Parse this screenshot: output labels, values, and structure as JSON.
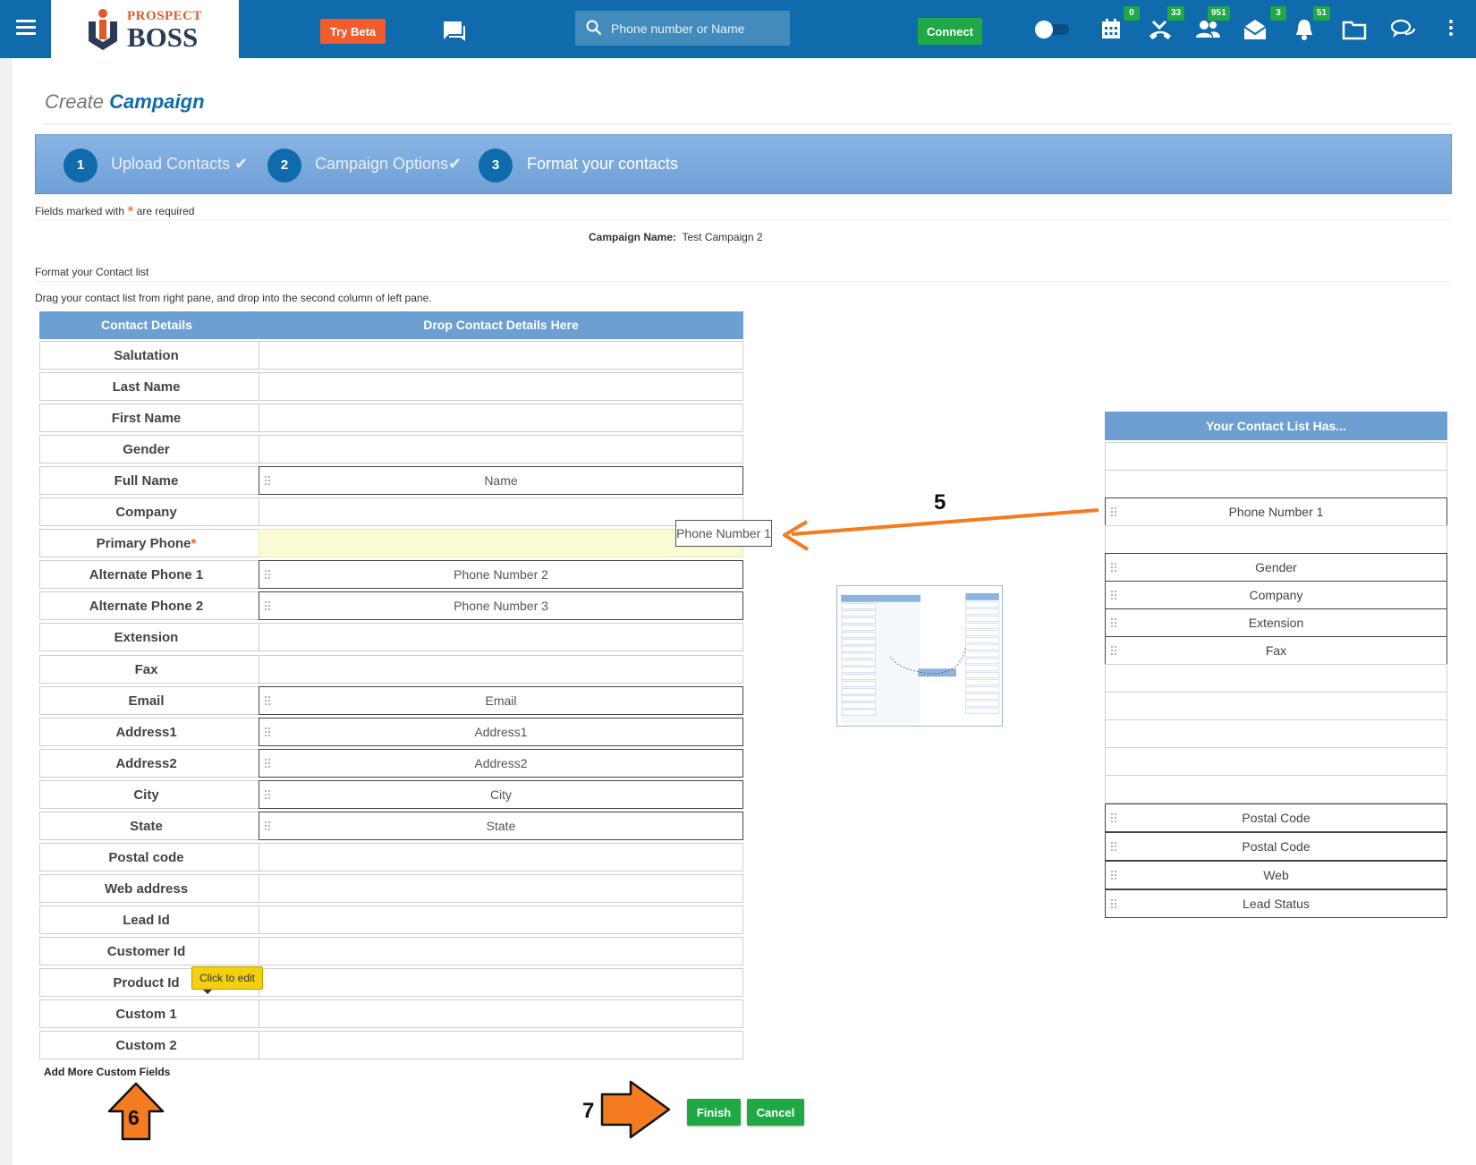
{
  "topbar": {
    "logo_top": "PROSPECT",
    "logo_bottom": "BOSS",
    "try_beta_label": "Try Beta",
    "search_placeholder": "Phone number or Name",
    "connect_label": "Connect",
    "icons": [
      {
        "name": "calendar-icon",
        "badge": "0"
      },
      {
        "name": "missed-call-icon",
        "badge": "33"
      },
      {
        "name": "contacts-icon",
        "badge": "951"
      },
      {
        "name": "mail-open-icon",
        "badge": "3"
      },
      {
        "name": "bell-icon",
        "badge": "51"
      },
      {
        "name": "folder-icon",
        "badge": ""
      },
      {
        "name": "chat-bubbles-icon",
        "badge": ""
      }
    ],
    "colors": {
      "bar": "#0f6bab",
      "try_beta": "#f05c2c",
      "connect": "#1fa845"
    }
  },
  "page": {
    "heading_create": "Create",
    "heading_campaign": "Campaign"
  },
  "steps": [
    {
      "number": "1",
      "label": "Upload Contacts",
      "done": true
    },
    {
      "number": "2",
      "label": "Campaign Options",
      "done": true
    },
    {
      "number": "3",
      "label": "Format your contacts",
      "done": false
    }
  ],
  "form": {
    "required_note_prefix": "Fields marked with",
    "required_note_suffix": "are required",
    "campaign_name_label": "Campaign Name:",
    "campaign_name_value": "Test Campaign 2",
    "section_title": "Format your Contact list",
    "instructions": "Drag your contact list from right pane, and drop into the second column of left pane.",
    "left_header_col1": "Contact Details",
    "left_header_col2": "Drop Contact Details Here",
    "rows": [
      {
        "label": "Salutation",
        "value": ""
      },
      {
        "label": "Last Name",
        "value": ""
      },
      {
        "label": "First Name",
        "value": ""
      },
      {
        "label": "Gender",
        "value": ""
      },
      {
        "label": "Full Name",
        "value": "Name"
      },
      {
        "label": "Company",
        "value": ""
      },
      {
        "label": "Primary Phone",
        "value": "",
        "required": true
      },
      {
        "label": "Alternate Phone 1",
        "value": "Phone Number 2"
      },
      {
        "label": "Alternate Phone 2",
        "value": "Phone Number 3"
      },
      {
        "label": "Extension",
        "value": ""
      },
      {
        "label": "Fax",
        "value": ""
      },
      {
        "label": "Email",
        "value": "Email"
      },
      {
        "label": "Address1",
        "value": "Address1"
      },
      {
        "label": "Address2",
        "value": "Address2"
      },
      {
        "label": "City",
        "value": "City"
      },
      {
        "label": "State",
        "value": "State"
      },
      {
        "label": "Postal code",
        "value": ""
      },
      {
        "label": "Web address",
        "value": ""
      },
      {
        "label": "Lead Id",
        "value": ""
      },
      {
        "label": "Customer Id",
        "value": ""
      },
      {
        "label": "Product Id",
        "value": ""
      },
      {
        "label": "Custom 1",
        "value": ""
      },
      {
        "label": "Custom 2",
        "value": ""
      }
    ],
    "dragging_item": "Phone Number 1",
    "tooltip": "Click to edit",
    "add_more_label": "Add More Custom Fields",
    "right_header": "Your Contact List Has...",
    "right_items": [
      "",
      "",
      "Phone Number 1",
      "",
      "Gender",
      "Company",
      "Extension",
      "Fax",
      "",
      "",
      "",
      "",
      "",
      "Postal Code",
      "Postal Code",
      "Web",
      "Lead Status"
    ],
    "finish_label": "Finish",
    "cancel_label": "Cancel"
  },
  "annotations": {
    "step5": "5",
    "step6": "6",
    "step7": "7",
    "arrow_color": "#f47b20"
  }
}
